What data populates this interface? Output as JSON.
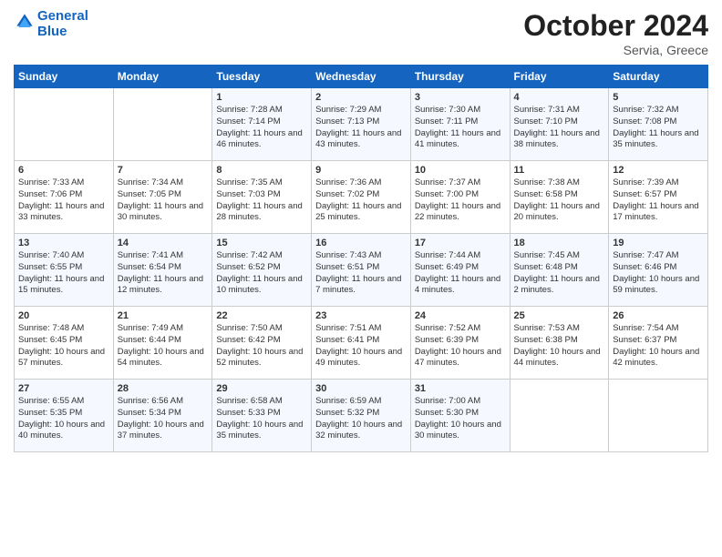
{
  "header": {
    "logo_line1": "General",
    "logo_line2": "Blue",
    "month": "October 2024",
    "location": "Servia, Greece"
  },
  "days_of_week": [
    "Sunday",
    "Monday",
    "Tuesday",
    "Wednesday",
    "Thursday",
    "Friday",
    "Saturday"
  ],
  "weeks": [
    [
      {
        "day": "",
        "info": ""
      },
      {
        "day": "",
        "info": ""
      },
      {
        "day": "1",
        "info": "Sunrise: 7:28 AM\nSunset: 7:14 PM\nDaylight: 11 hours\nand 46 minutes."
      },
      {
        "day": "2",
        "info": "Sunrise: 7:29 AM\nSunset: 7:13 PM\nDaylight: 11 hours\nand 43 minutes."
      },
      {
        "day": "3",
        "info": "Sunrise: 7:30 AM\nSunset: 7:11 PM\nDaylight: 11 hours\nand 41 minutes."
      },
      {
        "day": "4",
        "info": "Sunrise: 7:31 AM\nSunset: 7:10 PM\nDaylight: 11 hours\nand 38 minutes."
      },
      {
        "day": "5",
        "info": "Sunrise: 7:32 AM\nSunset: 7:08 PM\nDaylight: 11 hours\nand 35 minutes."
      }
    ],
    [
      {
        "day": "6",
        "info": "Sunrise: 7:33 AM\nSunset: 7:06 PM\nDaylight: 11 hours\nand 33 minutes."
      },
      {
        "day": "7",
        "info": "Sunrise: 7:34 AM\nSunset: 7:05 PM\nDaylight: 11 hours\nand 30 minutes."
      },
      {
        "day": "8",
        "info": "Sunrise: 7:35 AM\nSunset: 7:03 PM\nDaylight: 11 hours\nand 28 minutes."
      },
      {
        "day": "9",
        "info": "Sunrise: 7:36 AM\nSunset: 7:02 PM\nDaylight: 11 hours\nand 25 minutes."
      },
      {
        "day": "10",
        "info": "Sunrise: 7:37 AM\nSunset: 7:00 PM\nDaylight: 11 hours\nand 22 minutes."
      },
      {
        "day": "11",
        "info": "Sunrise: 7:38 AM\nSunset: 6:58 PM\nDaylight: 11 hours\nand 20 minutes."
      },
      {
        "day": "12",
        "info": "Sunrise: 7:39 AM\nSunset: 6:57 PM\nDaylight: 11 hours\nand 17 minutes."
      }
    ],
    [
      {
        "day": "13",
        "info": "Sunrise: 7:40 AM\nSunset: 6:55 PM\nDaylight: 11 hours\nand 15 minutes."
      },
      {
        "day": "14",
        "info": "Sunrise: 7:41 AM\nSunset: 6:54 PM\nDaylight: 11 hours\nand 12 minutes."
      },
      {
        "day": "15",
        "info": "Sunrise: 7:42 AM\nSunset: 6:52 PM\nDaylight: 11 hours\nand 10 minutes."
      },
      {
        "day": "16",
        "info": "Sunrise: 7:43 AM\nSunset: 6:51 PM\nDaylight: 11 hours\nand 7 minutes."
      },
      {
        "day": "17",
        "info": "Sunrise: 7:44 AM\nSunset: 6:49 PM\nDaylight: 11 hours\nand 4 minutes."
      },
      {
        "day": "18",
        "info": "Sunrise: 7:45 AM\nSunset: 6:48 PM\nDaylight: 11 hours\nand 2 minutes."
      },
      {
        "day": "19",
        "info": "Sunrise: 7:47 AM\nSunset: 6:46 PM\nDaylight: 10 hours\nand 59 minutes."
      }
    ],
    [
      {
        "day": "20",
        "info": "Sunrise: 7:48 AM\nSunset: 6:45 PM\nDaylight: 10 hours\nand 57 minutes."
      },
      {
        "day": "21",
        "info": "Sunrise: 7:49 AM\nSunset: 6:44 PM\nDaylight: 10 hours\nand 54 minutes."
      },
      {
        "day": "22",
        "info": "Sunrise: 7:50 AM\nSunset: 6:42 PM\nDaylight: 10 hours\nand 52 minutes."
      },
      {
        "day": "23",
        "info": "Sunrise: 7:51 AM\nSunset: 6:41 PM\nDaylight: 10 hours\nand 49 minutes."
      },
      {
        "day": "24",
        "info": "Sunrise: 7:52 AM\nSunset: 6:39 PM\nDaylight: 10 hours\nand 47 minutes."
      },
      {
        "day": "25",
        "info": "Sunrise: 7:53 AM\nSunset: 6:38 PM\nDaylight: 10 hours\nand 44 minutes."
      },
      {
        "day": "26",
        "info": "Sunrise: 7:54 AM\nSunset: 6:37 PM\nDaylight: 10 hours\nand 42 minutes."
      }
    ],
    [
      {
        "day": "27",
        "info": "Sunrise: 6:55 AM\nSunset: 5:35 PM\nDaylight: 10 hours\nand 40 minutes."
      },
      {
        "day": "28",
        "info": "Sunrise: 6:56 AM\nSunset: 5:34 PM\nDaylight: 10 hours\nand 37 minutes."
      },
      {
        "day": "29",
        "info": "Sunrise: 6:58 AM\nSunset: 5:33 PM\nDaylight: 10 hours\nand 35 minutes."
      },
      {
        "day": "30",
        "info": "Sunrise: 6:59 AM\nSunset: 5:32 PM\nDaylight: 10 hours\nand 32 minutes."
      },
      {
        "day": "31",
        "info": "Sunrise: 7:00 AM\nSunset: 5:30 PM\nDaylight: 10 hours\nand 30 minutes."
      },
      {
        "day": "",
        "info": ""
      },
      {
        "day": "",
        "info": ""
      }
    ]
  ]
}
